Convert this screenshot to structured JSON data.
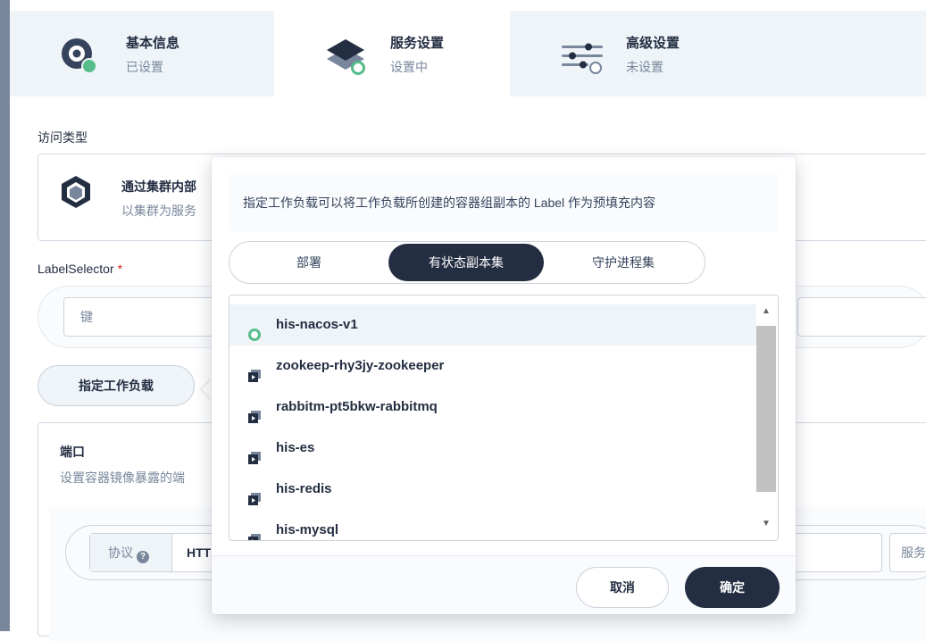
{
  "steps": [
    {
      "title": "基本信息",
      "status": "已设置",
      "icon": "basic-info-icon"
    },
    {
      "title": "服务设置",
      "status": "设置中",
      "icon": "service-settings-icon"
    },
    {
      "title": "高级设置",
      "status": "未设置",
      "icon": "advanced-settings-icon"
    }
  ],
  "access": {
    "label": "访问类型",
    "card_title": "通过集群内部",
    "card_desc": "以集群为服务"
  },
  "label_selector": {
    "label": "LabelSelector",
    "required_mark": "*",
    "key_placeholder": "键"
  },
  "workload_button": "指定工作负载",
  "port": {
    "title": "端口",
    "desc": "设置容器镜像暴露的端",
    "protocol_label": "协议",
    "help_glyph": "?",
    "protocol_value": "HTTP",
    "service_port_label": "服务端口"
  },
  "popover": {
    "tip": "指定工作负载可以将工作负载所创建的容器组副本的 Label 作为预填充内容",
    "tabs": [
      "部署",
      "有状态副本集",
      "守护进程集"
    ],
    "active_tab": 1,
    "items": [
      {
        "name": "his-nacos-v1",
        "selected": true
      },
      {
        "name": "zookeep-rhy3jy-zookeeper",
        "selected": false
      },
      {
        "name": "rabbitm-pt5bkw-rabbitmq",
        "selected": false
      },
      {
        "name": "his-es",
        "selected": false
      },
      {
        "name": "his-redis",
        "selected": false
      },
      {
        "name": "his-mysql",
        "selected": false
      }
    ],
    "cancel_label": "取消",
    "ok_label": "确定"
  },
  "colors": {
    "accent": "#242e42",
    "success": "#55bc8a",
    "header_bg": "#eff4f9"
  }
}
